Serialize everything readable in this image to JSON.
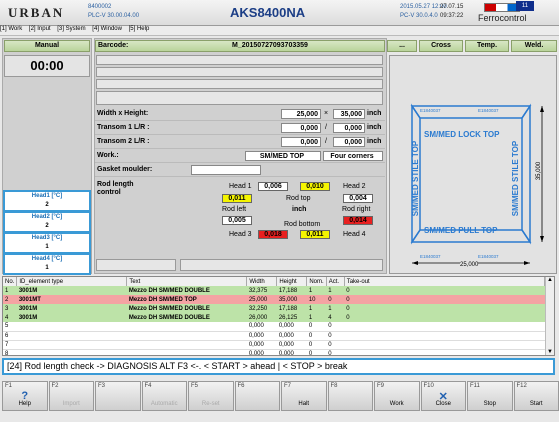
{
  "header": {
    "logo": "URBAN",
    "version1": "8400002",
    "version2": "PLC-V 30.00.04.00",
    "title": "AKS8400NA",
    "date1": "2015.05.27 12:00",
    "date2": "PC-V 30.0.4.0",
    "time1": "27.07.15",
    "time2": "09:37:22",
    "brand": "Ferrocontrol",
    "day": "11"
  },
  "menu": [
    "[1] Work",
    "[2] Input",
    "[3] System",
    "[4] Window",
    "[5] Help"
  ],
  "mode": "Manual",
  "timer": "00:00",
  "barcode": {
    "label": "Barcode:",
    "value": "M_20150727093703359",
    "dots": "...",
    "cross": "Cross",
    "temp": "Temp.",
    "weld": "Weld."
  },
  "fields": {
    "wh_label": "Width x Height:",
    "width": "25,000",
    "x": "×",
    "height": "35,000",
    "unit": "inch",
    "t1_label": "Transom 1 L/R :",
    "t1l": "0,000",
    "t1r": "0,000",
    "t2_label": "Transom 2 L/R :",
    "t2l": "0,000",
    "t2r": "0,000",
    "slash": "/",
    "work_label": "Work.:",
    "work": "SM/MED TOP",
    "corners": "Four corners",
    "gasket_label": "Gasket moulder:",
    "rod_label": "Rod length control"
  },
  "rod": {
    "head1": "Head 1",
    "v1": "0,006",
    "v2": "0,010",
    "head2": "Head 2",
    "y1": "0,011",
    "rodtop": "Rod top",
    "rt": "0,004",
    "rodleft": "Rod left",
    "inch": "inch",
    "rodright": "Rod right",
    "rl": "0,005",
    "rr": "0,014",
    "rodbottom": "Rod bottom",
    "head3": "Head 3",
    "b1": "0,018",
    "b2": "0,011",
    "head4": "Head 4"
  },
  "heads": [
    {
      "label": "Head1 [°C]",
      "value": "2"
    },
    {
      "label": "Head2 [°C]",
      "value": "2"
    },
    {
      "label": "Head3 [°C]",
      "value": "1"
    },
    {
      "label": "Head4 [°C]",
      "value": "1"
    }
  ],
  "diagram": {
    "top": "SM/MED LOCK TOP",
    "bottom": "SM/MED PULL TOP",
    "left": "SM/MED STILE TOP",
    "right": "SM/MED STILE TOP",
    "height": "35,000",
    "width": "25,000",
    "tag": "E1840037"
  },
  "table": {
    "headers": [
      "No.",
      "ID_element type",
      "Text",
      "Width",
      "Height",
      "Nom.",
      "Act.",
      "Take-out"
    ],
    "rows": [
      [
        "1",
        "3001M",
        "Mezzo DH SM/MED DOUBLE",
        "32,375",
        "17,188",
        "1",
        "1",
        "0"
      ],
      [
        "2",
        "3001MT",
        "Mezzo DH SM/MED TOP",
        "25,000",
        "35,000",
        "10",
        "0",
        "0"
      ],
      [
        "3",
        "3001M",
        "Mezzo DH SM/MED DOUBLE",
        "32,250",
        "17,188",
        "1",
        "1",
        "0"
      ],
      [
        "4",
        "3001M",
        "Mezzo DH SM/MED DOUBLE",
        "26,000",
        "26,125",
        "1",
        "4",
        "0"
      ],
      [
        "5",
        "",
        "",
        "0,000",
        "0,000",
        "0",
        "0",
        ""
      ],
      [
        "6",
        "",
        "",
        "0,000",
        "0,000",
        "0",
        "0",
        ""
      ],
      [
        "7",
        "",
        "",
        "0,000",
        "0,000",
        "0",
        "0",
        ""
      ],
      [
        "8",
        "",
        "",
        "0,000",
        "0,000",
        "0",
        "0",
        ""
      ]
    ]
  },
  "message": "[24] Rod length check -> DIAGNOSIS ALT F3 <-. < START > ahead  | < STOP > break",
  "fkeys": [
    {
      "key": "F1",
      "label": "Help",
      "icon": "?"
    },
    {
      "key": "F2",
      "label": "Import",
      "icon": ""
    },
    {
      "key": "F3",
      "label": "",
      "icon": ""
    },
    {
      "key": "F4",
      "label": "Automatic",
      "icon": ""
    },
    {
      "key": "F5",
      "label": "Re-set",
      "icon": ""
    },
    {
      "key": "F6",
      "label": "",
      "icon": ""
    },
    {
      "key": "F7",
      "label": "Halt",
      "icon": ""
    },
    {
      "key": "F8",
      "label": "",
      "icon": ""
    },
    {
      "key": "F9",
      "label": "Work",
      "icon": ""
    },
    {
      "key": "F10",
      "label": "Close",
      "icon": "✕"
    },
    {
      "key": "F11",
      "label": "Stop",
      "icon": ""
    },
    {
      "key": "F12",
      "label": "Start",
      "icon": ""
    }
  ]
}
